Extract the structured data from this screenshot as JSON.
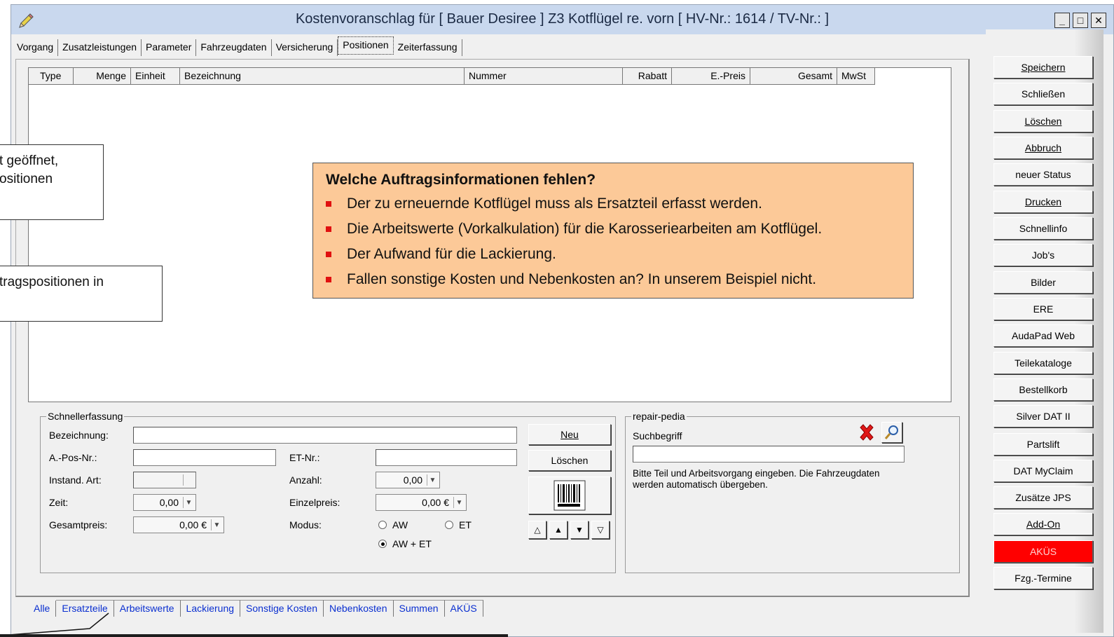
{
  "window": {
    "title": "Kostenvoranschlag  für [ Bauer Desiree ] Z3 Kotflügel re. vorn [ HV-Nr.: 1614 / TV-Nr.:  ]",
    "controls": [
      "_",
      "□",
      "✕"
    ]
  },
  "top_tabs": [
    "Vorgang",
    "Zusatzleistungen",
    "Parameter",
    "Fahrzeugdaten",
    "Versicherung",
    "Positionen",
    "Zeiterfassung"
  ],
  "active_top_tab": "Positionen",
  "grid": {
    "columns": [
      "Type",
      "Menge",
      "Einheit",
      "Bezeichnung",
      "Nummer",
      "Rabatt",
      "E.-Preis",
      "Gesamt",
      "MwSt"
    ]
  },
  "schnellerfassung": {
    "legend": "Schnellerfassung",
    "bezeichnung_label": "Bezeichnung:",
    "apos_label": "A.-Pos-Nr.:",
    "etnr_label": "ET-Nr.:",
    "instand_label": "Instand. Art:",
    "anzahl_label": "Anzahl:",
    "anzahl_value": "0,00",
    "zeit_label": "Zeit:",
    "zeit_value": "0,00",
    "einzelpreis_label": "Einzelpreis:",
    "einzelpreis_value": "0,00 €",
    "gesamtpreis_label": "Gesamtpreis:",
    "gesamtpreis_value": "0,00 €",
    "modus_label": "Modus:",
    "modus_options": [
      "AW",
      "ET",
      "AW + ET"
    ],
    "modus_selected": "AW + ET",
    "neu_button": "Neu",
    "loeschen_button": "Löschen"
  },
  "repair_pedia": {
    "legend": "repair-pedia",
    "suchbegriff_label": "Suchbegriff",
    "hint": "Bitte Teil und Arbeitsvorgang eingeben. Die Fahrzeugdaten werden automatisch übergeben."
  },
  "bottom_tabs": [
    "Alle",
    "Ersatzteile",
    "Arbeitswerte",
    "Lackierung",
    "Sonstige Kosten",
    "Nebenkosten",
    "Summen",
    "AKÜS"
  ],
  "sidebar_buttons": [
    "Speichern",
    "Schließen",
    "Löschen",
    "Abbruch",
    "neuer Status",
    "Drucken",
    "Schnellinfo",
    "Job's",
    "Bilder",
    "ERE",
    "AudaPad Web",
    "Teilekataloge",
    "Bestellkorb",
    "Silver DAT II",
    "Partslift",
    "DAT MyClaim",
    "Zusätze JPS",
    "Add-On",
    "AKÜS",
    "Fzg.-Termine"
  ],
  "highlight_color": "#ff0000",
  "callout": {
    "title": "Welche Auftragsinformationen fehlen?",
    "items": [
      "Der zu erneuernde Kotflügel muss als Ersatzteil erfasst werden.",
      "Die Arbeitswerte (Vorkalkulation) für die Karosseriearbeiten am Kotflügel.",
      "Der Aufwand für die Lackierung.",
      "Fallen sonstige Kosten und Nebenkosten an? In unserem Beispiel nicht."
    ]
  },
  "notes": {
    "note1_line1": "t geöffnet,",
    "note1_line2": "ositionen",
    "note2_line1": "tragspositionen in"
  }
}
